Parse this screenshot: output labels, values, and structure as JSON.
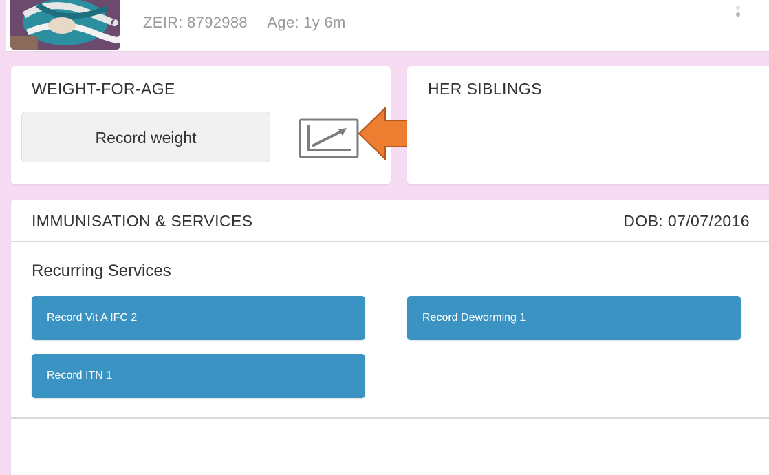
{
  "header": {
    "zeir_id": "ZEIR: 8792988",
    "age": "Age: 1y 6m"
  },
  "weight_card": {
    "title": "WEIGHT-FOR-AGE",
    "record_button_label": "Record weight",
    "chart_icon": "growth-chart-icon"
  },
  "siblings_card": {
    "title": "HER SIBLINGS"
  },
  "immunisation": {
    "title": "IMMUNISATION & SERVICES",
    "dob": "DOB: 07/07/2016",
    "section_label": "Recurring Services",
    "services": [
      {
        "label": "Record Vit A IFC 2"
      },
      {
        "label": "Record Deworming 1"
      },
      {
        "label": "Record ITN 1"
      }
    ]
  },
  "colors": {
    "background": "#f6dcf3",
    "service_button": "#3a93c3",
    "callout_arrow": "#ed7d31"
  }
}
